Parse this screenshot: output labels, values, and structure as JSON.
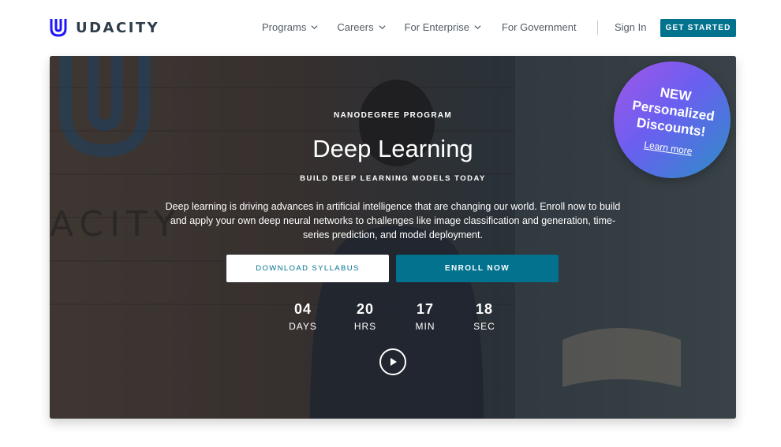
{
  "brand": {
    "name": "UDACITY"
  },
  "nav": {
    "items": [
      {
        "label": "Programs",
        "has_dropdown": true
      },
      {
        "label": "Careers",
        "has_dropdown": true
      },
      {
        "label": "For Enterprise",
        "has_dropdown": true
      },
      {
        "label": "For Government",
        "has_dropdown": false
      }
    ],
    "sign_in": "Sign In",
    "cta": "GET STARTED"
  },
  "hero": {
    "eyebrow": "NANODEGREE PROGRAM",
    "title": "Deep Learning",
    "subtitle": "BUILD DEEP LEARNING MODELS TODAY",
    "description": "Deep learning is driving advances in artificial intelligence that are changing our world. Enroll now to build and apply your own deep neural networks to challenges like image classification and generation, time-series prediction, and model deployment.",
    "download_button": "DOWNLOAD SYLLABUS",
    "enroll_button": "ENROLL NOW",
    "countdown": [
      {
        "value": "04",
        "label": "DAYS"
      },
      {
        "value": "20",
        "label": "HRS"
      },
      {
        "value": "17",
        "label": "MIN"
      },
      {
        "value": "18",
        "label": "SEC"
      }
    ],
    "play_icon": "play-circle-icon"
  },
  "promo": {
    "line1": "NEW",
    "line2": "Personalized",
    "line3": "Discounts!",
    "link": "Learn more"
  },
  "colors": {
    "accent": "#02728f",
    "text": "#2e3d49",
    "badge_purple": "#a256e8",
    "badge_blue": "#2c8fc7"
  }
}
